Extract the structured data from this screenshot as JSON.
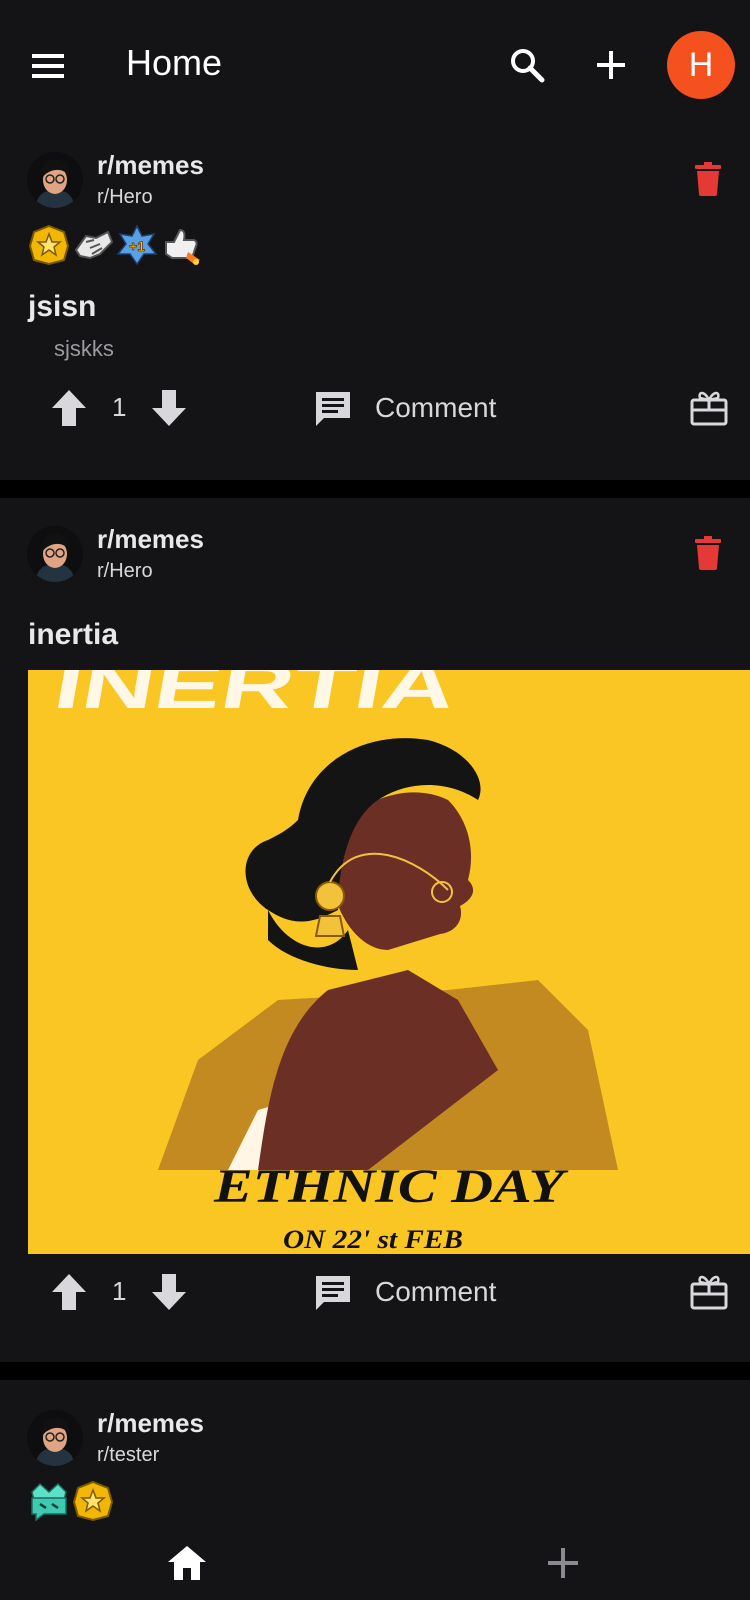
{
  "header": {
    "title": "Home",
    "avatar_letter": "H",
    "accent": "#f4511e"
  },
  "posts": [
    {
      "community": "r/memes",
      "user": "r/Hero",
      "awards": [
        "star-award-icon",
        "handshake-award-icon",
        "plus-one-award-icon",
        "thumbs-up-rocket-award-icon"
      ],
      "title": "jsisn",
      "body": "sjskks",
      "votes": "1",
      "comment_label": "Comment"
    },
    {
      "community": "r/memes",
      "user": "r/Hero",
      "title": "inertia",
      "image": {
        "top_text": "INERTIA",
        "caption": "ETHNIC DAY",
        "subcaption": "ON 22' st FEB",
        "background": "#f9c624"
      },
      "votes": "1",
      "comment_label": "Comment"
    },
    {
      "community": "r/memes",
      "user": "r/tester",
      "awards": [
        "crown-chat-award-icon",
        "star-award-icon"
      ]
    }
  ],
  "colors": {
    "background": "#000000",
    "card": "#141416",
    "delete": "#e53935",
    "text_muted": "#9a9aa0"
  }
}
